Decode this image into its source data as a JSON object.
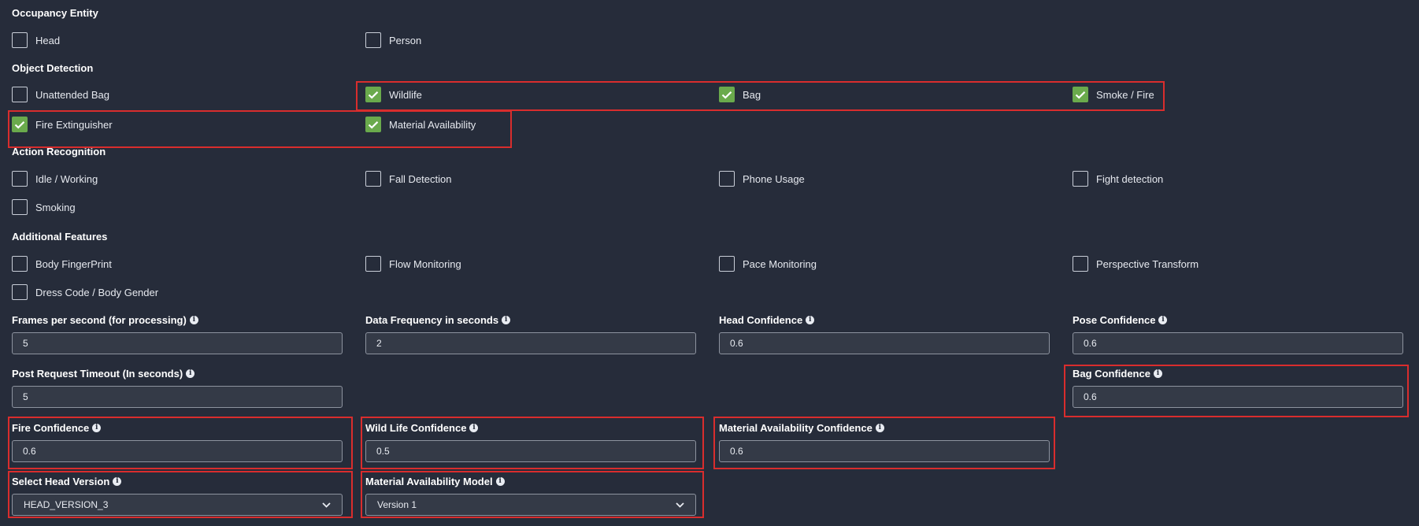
{
  "sections": {
    "occupancy_entity": "Occupancy Entity",
    "object_detection": "Object Detection",
    "action_recognition": "Action Recognition",
    "additional_features": "Additional Features"
  },
  "checkboxes": {
    "head": {
      "label": "Head",
      "checked": false
    },
    "person": {
      "label": "Person",
      "checked": false
    },
    "unattended_bag": {
      "label": "Unattended Bag",
      "checked": false
    },
    "wildlife": {
      "label": "Wildlife",
      "checked": true
    },
    "bag": {
      "label": "Bag",
      "checked": true
    },
    "smoke_fire": {
      "label": "Smoke / Fire",
      "checked": true
    },
    "fire_extinguisher": {
      "label": "Fire Extinguisher",
      "checked": true
    },
    "material_availability": {
      "label": "Material Availability",
      "checked": true
    },
    "idle_working": {
      "label": "Idle / Working",
      "checked": false
    },
    "fall_detection": {
      "label": "Fall Detection",
      "checked": false
    },
    "phone_usage": {
      "label": "Phone Usage",
      "checked": false
    },
    "fight_detection": {
      "label": "Fight detection",
      "checked": false
    },
    "smoking": {
      "label": "Smoking",
      "checked": false
    },
    "body_fingerprint": {
      "label": "Body FingerPrint",
      "checked": false
    },
    "flow_monitoring": {
      "label": "Flow Monitoring",
      "checked": false
    },
    "pace_monitoring": {
      "label": "Pace Monitoring",
      "checked": false
    },
    "perspective_transform": {
      "label": "Perspective Transform",
      "checked": false
    },
    "dress_code": {
      "label": "Dress Code / Body Gender",
      "checked": false
    }
  },
  "fields": {
    "fps": {
      "label": "Frames per second (for processing)",
      "value": "5"
    },
    "data_frequency": {
      "label": "Data Frequency in seconds",
      "value": "2"
    },
    "head_confidence": {
      "label": "Head Confidence",
      "value": "0.6"
    },
    "pose_confidence": {
      "label": "Pose Confidence",
      "value": "0.6"
    },
    "post_timeout": {
      "label": "Post Request Timeout (In seconds)",
      "value": "5"
    },
    "bag_confidence": {
      "label": "Bag Confidence",
      "value": "0.6"
    },
    "fire_confidence": {
      "label": "Fire Confidence",
      "value": "0.6"
    },
    "wildlife_confidence": {
      "label": "Wild Life Confidence",
      "value": "0.5"
    },
    "material_confidence": {
      "label": "Material Availability Confidence",
      "value": "0.6"
    }
  },
  "selects": {
    "head_version": {
      "label": "Select Head Version",
      "value": "HEAD_VERSION_3"
    },
    "material_model": {
      "label": "Material Availability Model",
      "value": "Version 1"
    }
  },
  "icons": {
    "info": "info-icon",
    "check": "check-icon",
    "chevron": "chevron-down-icon"
  },
  "colors": {
    "background": "#262c3a",
    "checked": "#6aaa4c",
    "highlight": "#d92d2d",
    "input_bg": "#343a47"
  }
}
